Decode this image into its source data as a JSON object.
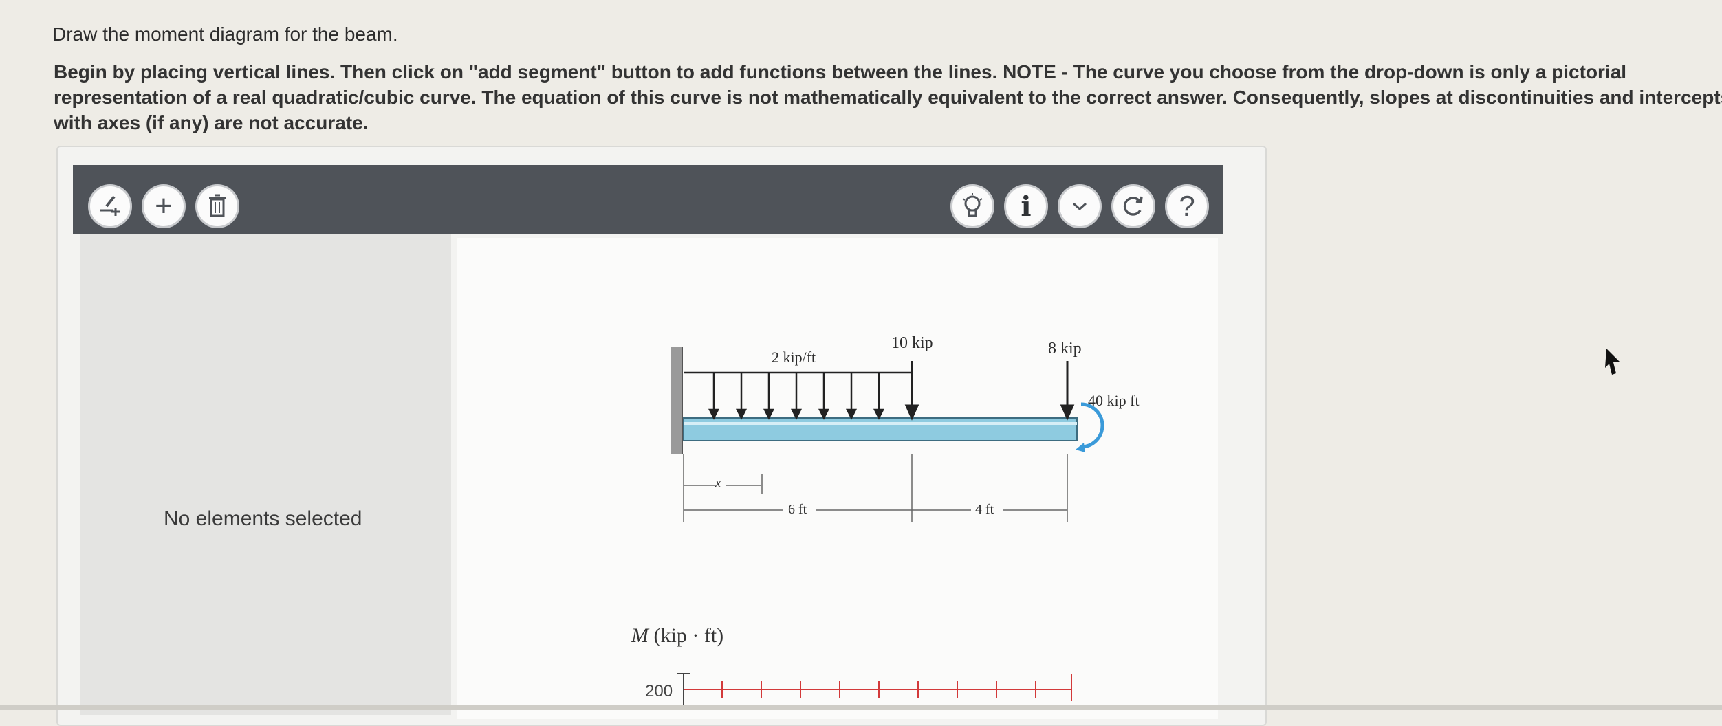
{
  "question": {
    "prompt": "Draw the moment diagram for the beam.",
    "instructions": "Begin by placing vertical lines. Then click on \"add segment\" button to add functions between the lines. NOTE - The curve you choose from the drop-down is only a pictorial representation of a real quadratic/cubic curve. The equation of this curve is not mathematically equivalent to the correct answer. Consequently, slopes at discontinuities and intercepts with axes (if any) are not accurate."
  },
  "toolbar": {
    "left_buttons": [
      "add-vertical-line-icon",
      "add-segment-icon",
      "delete-icon"
    ],
    "right_buttons": [
      "lightbulb-icon",
      "info-icon",
      "chevron-down-icon",
      "redo-icon",
      "help-icon"
    ],
    "info_glyph": "i",
    "help_glyph": "?",
    "plus_glyph": "+",
    "chevron_glyph": "v"
  },
  "sidebar": {
    "empty_text": "No elements selected"
  },
  "figure": {
    "distributed_load": "2 kip/ft",
    "point_load_1": "10 kip",
    "point_load_2": "8 kip",
    "moment": "40 kip ft",
    "dim_x": "x",
    "dim_1": "6 ft",
    "dim_2": "4 ft"
  },
  "graph": {
    "ylabel_var": "M",
    "ylabel_units": "(kip · ft)",
    "y_tick_top": "200"
  },
  "colors": {
    "toolbar": "#4f5359",
    "beam": "#8ecbe0",
    "moment_arrow": "#3a9ad9",
    "grid_ticks": "#d33a3a"
  }
}
